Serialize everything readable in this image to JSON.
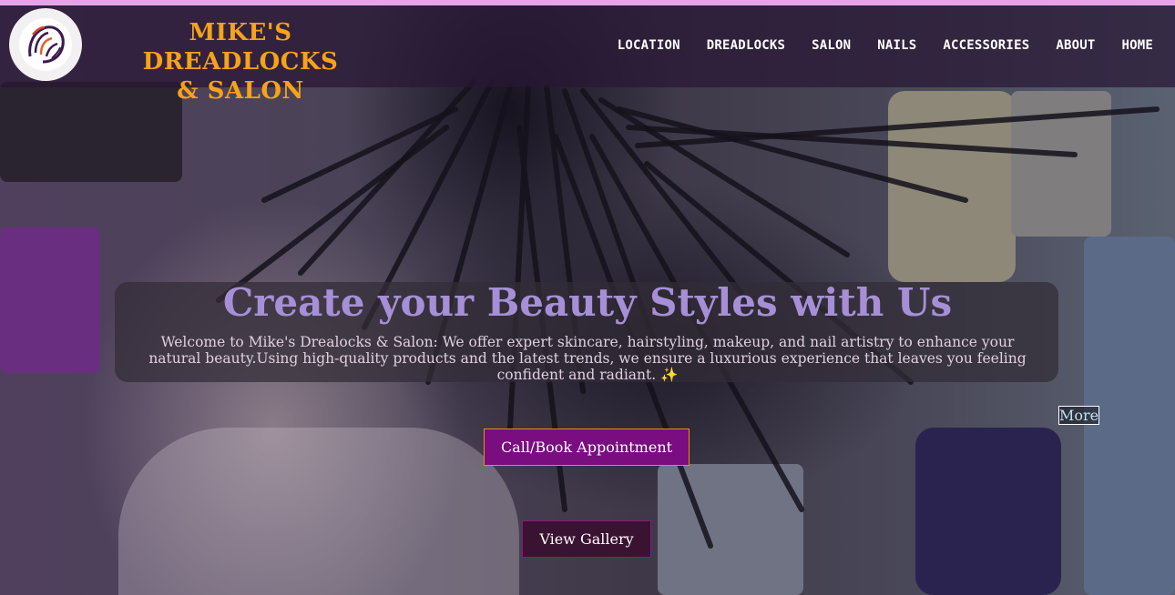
{
  "brand": {
    "logo_icon": "lion-mane-logo-icon",
    "name_line1": "MIKE'S DREADLOCKS",
    "name_line2": "& SALON"
  },
  "nav": {
    "items": [
      "LOCATION",
      "DREADLOCKS",
      "SALON",
      "NAILS",
      "ACCESSORIES",
      "ABOUT",
      "HOME"
    ]
  },
  "hero": {
    "title": "Create your Beauty Styles with Us",
    "description": "Welcome to Mike's Drealocks & Salon: We offer expert skincare, hairstyling, makeup, and nail artistry to enhance your natural beauty.Using high-quality products and the latest trends, we ensure a luxurious experience that leaves you feeling confident and radiant. ✨",
    "more_label": "More",
    "book_label": "Call/Book Appointment",
    "gallery_label": "View Gallery"
  },
  "colors": {
    "accent_strip": "#e7a3ea",
    "brand_orange": "#f6a21a",
    "title_purple": "#a68fd6",
    "book_button": "#7a0d80"
  }
}
